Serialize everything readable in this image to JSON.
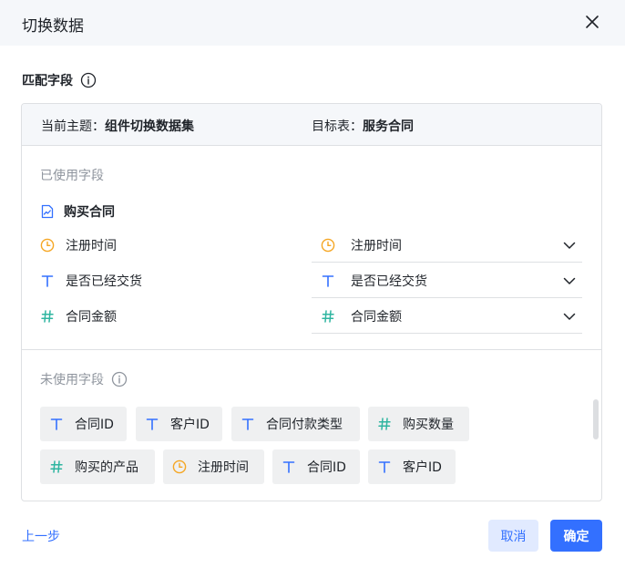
{
  "dialog": {
    "title": "切换数据",
    "close_icon": "close-icon"
  },
  "match": {
    "title": "匹配字段",
    "info_icon": "info-icon"
  },
  "panel": {
    "current_theme_label": "当前主题：",
    "current_theme_value": "组件切换数据集",
    "target_label": "目标表：",
    "target_value": "服务合同"
  },
  "used": {
    "label": "已使用字段",
    "group_title": "购买合同",
    "group_icon": "chart-file-icon",
    "rows": [
      {
        "source": "注册时间",
        "source_icon": "clock-icon",
        "target": "注册时间",
        "target_icon": "clock-icon"
      },
      {
        "source": "是否已经交货",
        "source_icon": "text-type-icon",
        "target": "是否已经交货",
        "target_icon": "text-type-icon"
      },
      {
        "source": "合同金额",
        "source_icon": "number-hash-icon",
        "target": "合同金额",
        "target_icon": "number-hash-icon"
      }
    ]
  },
  "unused": {
    "label": "未使用字段",
    "chips": [
      {
        "label": "合同ID",
        "icon": "text-type-icon"
      },
      {
        "label": "客户ID",
        "icon": "text-type-icon"
      },
      {
        "label": "合同付款类型",
        "icon": "text-type-icon"
      },
      {
        "label": "购买数量",
        "icon": "number-hash-icon"
      },
      {
        "label": "购买的产品",
        "icon": "number-hash-icon"
      },
      {
        "label": "注册时间",
        "icon": "clock-icon"
      },
      {
        "label": "合同ID",
        "icon": "text-type-icon"
      },
      {
        "label": "客户ID",
        "icon": "text-type-icon"
      }
    ]
  },
  "footer": {
    "prev": "上一步",
    "cancel": "取消",
    "confirm": "确定"
  },
  "colors": {
    "accent": "#3370ff",
    "clock": "#f5a623",
    "text_type": "#3370ff",
    "number": "#2eb5a0"
  }
}
